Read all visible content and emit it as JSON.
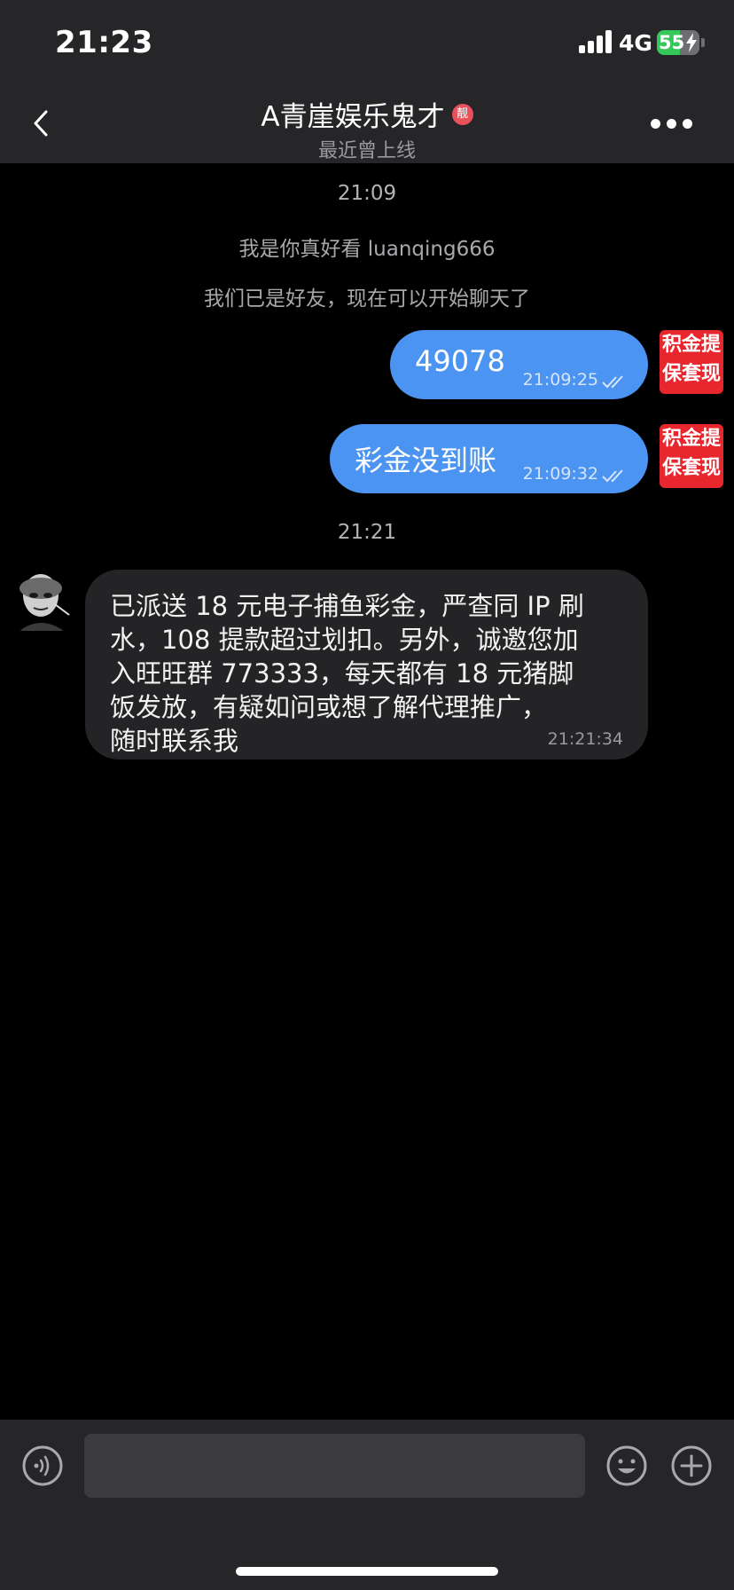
{
  "status_bar": {
    "time": "21:23",
    "network": "4G",
    "battery": "55",
    "battery_fraction": 0.55
  },
  "header": {
    "title": "A青崖娱乐鬼才",
    "badge": "靓",
    "subtitle": "最近曾上线",
    "back_icon": "chevron-left-icon",
    "more_icon": "ellipsis-icon"
  },
  "chat": {
    "divider_1": "21:09",
    "system_1": "我是你真好看 luanqing666",
    "system_2": "我们已是好友，现在可以开始聊天了",
    "messages_out": [
      {
        "text": "49078",
        "time": "21:09:25"
      },
      {
        "text": "彩金没到账",
        "time": "21:09:32"
      }
    ],
    "stickers": [
      {
        "line1": "积金提",
        "line2": "保套现"
      },
      {
        "line1": "积金提",
        "line2": "保套现"
      }
    ],
    "divider_2": "21:21",
    "message_in": {
      "lines": [
        "已派送 18 元电子捕鱼彩金，严查同 IP 刷",
        "水，108 提款超过划扣。另外，诚邀您加",
        "入旺旺群 773333，每天都有 18 元猪脚",
        "饭发放，有疑如问或想了解代理推广，",
        "随时联系我"
      ],
      "time": "21:21:34"
    }
  },
  "input_bar": {
    "placeholder": "",
    "voice_icon": "voice-icon",
    "emoji_icon": "emoji-icon",
    "plus_icon": "plus-icon"
  },
  "colors": {
    "outgoing_bubble": "#4c94f2",
    "incoming_bubble": "#242426",
    "bar_background": "#262628",
    "sticker_red": "#e8262e",
    "battery_green": "#34c759"
  }
}
